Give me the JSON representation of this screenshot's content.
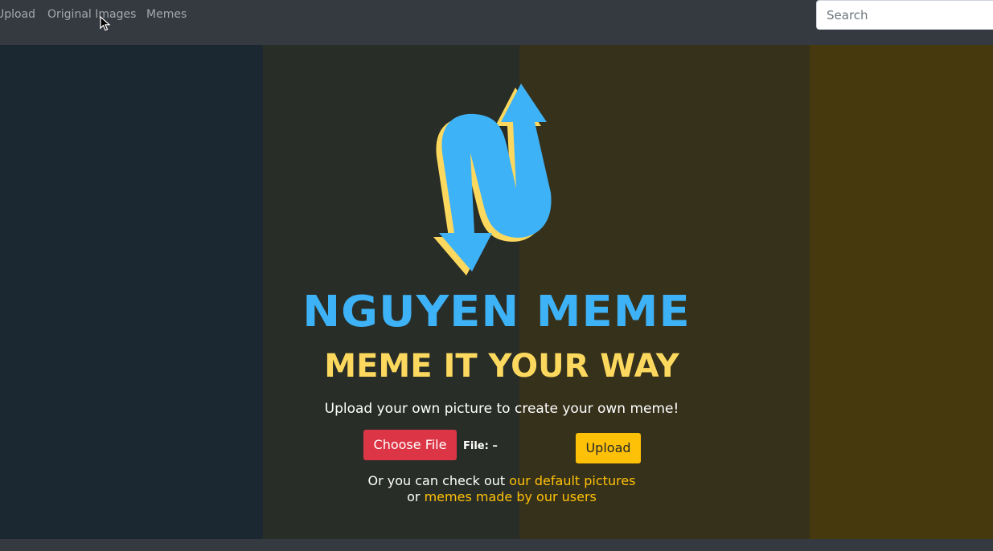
{
  "navbar": {
    "links": [
      {
        "label": "Upload"
      },
      {
        "label": "Original Images"
      },
      {
        "label": "Memes"
      }
    ],
    "search": {
      "placeholder": "Search",
      "value": ""
    }
  },
  "hero": {
    "logo_icon": "nguyen-meme-n-arrows-logo",
    "title": "NGUYEN MEME",
    "tagline": "MEME IT YOUR WAY",
    "subtitle": "Upload your own picture to create your own meme!",
    "choose_file_label": "Choose File",
    "file_status": "File: –",
    "upload_label": "Upload",
    "more": {
      "line1_prefix": "Or you can check out ",
      "default_pictures_link": "our default pictures",
      "line2_prefix": "or ",
      "user_memes_link": "memes made by our users"
    }
  },
  "colors": {
    "navbar": "#343a40",
    "logo_blue": "#3eb2f7",
    "logo_yellow": "#fcd95e",
    "choose_button": "#dc3545",
    "upload_button": "#ffc107",
    "link": "#ffc107"
  }
}
